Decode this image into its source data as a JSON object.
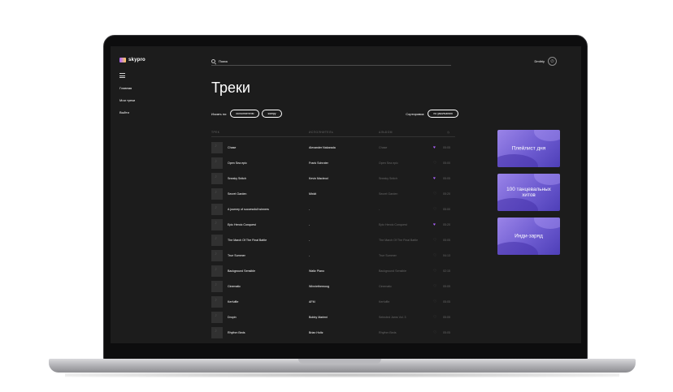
{
  "sidebar": {
    "logo": "skypro",
    "nav": [
      "Главная",
      "Мои треки",
      "Выйти"
    ]
  },
  "search": {
    "placeholder": "Поиск"
  },
  "user": {
    "name": "Dmitriy"
  },
  "page": {
    "title": "Треки"
  },
  "filters": {
    "label": "Искать по:",
    "chips": [
      "исполнителю",
      "жанру"
    ],
    "sort_label": "Сортировка:",
    "sort_value": "по умолчанию"
  },
  "table": {
    "headers": {
      "track": "ТРЕК",
      "artist": "ИСПОЛНИТЕЛЬ",
      "album": "АЛЬБОМ",
      "time_icon": "clock-icon"
    },
    "rows": [
      {
        "track": "Chase",
        "artist": "Alexander Nakarada",
        "album": "Chase",
        "liked": true,
        "time": "05:05"
      },
      {
        "track": "Open Sea epic",
        "artist": "Frank Schroter",
        "album": "Open Sea epic",
        "liked": false,
        "time": "05:00"
      },
      {
        "track": "Sneaky Snitch",
        "artist": "Kevin Macleod",
        "album": "Sneaky Snitch",
        "liked": true,
        "time": "05:05"
      },
      {
        "track": "Secret Garden",
        "artist": "Mixkit",
        "album": "Secret Garden",
        "liked": false,
        "time": "05:20"
      },
      {
        "track": "A journey of successfull winners",
        "artist": "-",
        "album": "-",
        "liked": false,
        "time": "05:00"
      },
      {
        "track": "Epic Heroic Conquest",
        "artist": "-",
        "album": "Epic Heroic Conquest",
        "liked": true,
        "time": "05:20"
      },
      {
        "track": "The March Of The Final Battle",
        "artist": "-",
        "album": "The March Of The Final Battle",
        "liked": false,
        "time": "05:05"
      },
      {
        "track": "True Summer",
        "artist": "-",
        "album": "True Summer",
        "liked": false,
        "time": "04:13"
      },
      {
        "track": "Background Sensible",
        "artist": "Waltz Piano",
        "album": "Background Sensible",
        "liked": false,
        "time": "02:15"
      },
      {
        "track": "Cinematic",
        "artist": "Winniethemoog",
        "album": "Cinematic",
        "liked": false,
        "time": "05:05"
      },
      {
        "track": "Kerfuffle",
        "artist": "AFM",
        "album": "Kerfuffle",
        "liked": false,
        "time": "05:05"
      },
      {
        "track": "Dropin",
        "artist": "Bobby Marleni",
        "album": "Selected Jams Vol. 3",
        "liked": false,
        "time": "05:05"
      },
      {
        "track": "Rhythm Beds",
        "artist": "Brian Holtz",
        "album": "Rhythm Beds",
        "liked": false,
        "time": "05:05"
      }
    ]
  },
  "playlists": [
    "Плейлист дня",
    "100 танцевальных хитов",
    "Инди-заряд"
  ],
  "colors": {
    "background": "#1c1c1c",
    "accent": "#ad61ff",
    "muted": "#696969",
    "playlist": "#6d5bd0"
  }
}
